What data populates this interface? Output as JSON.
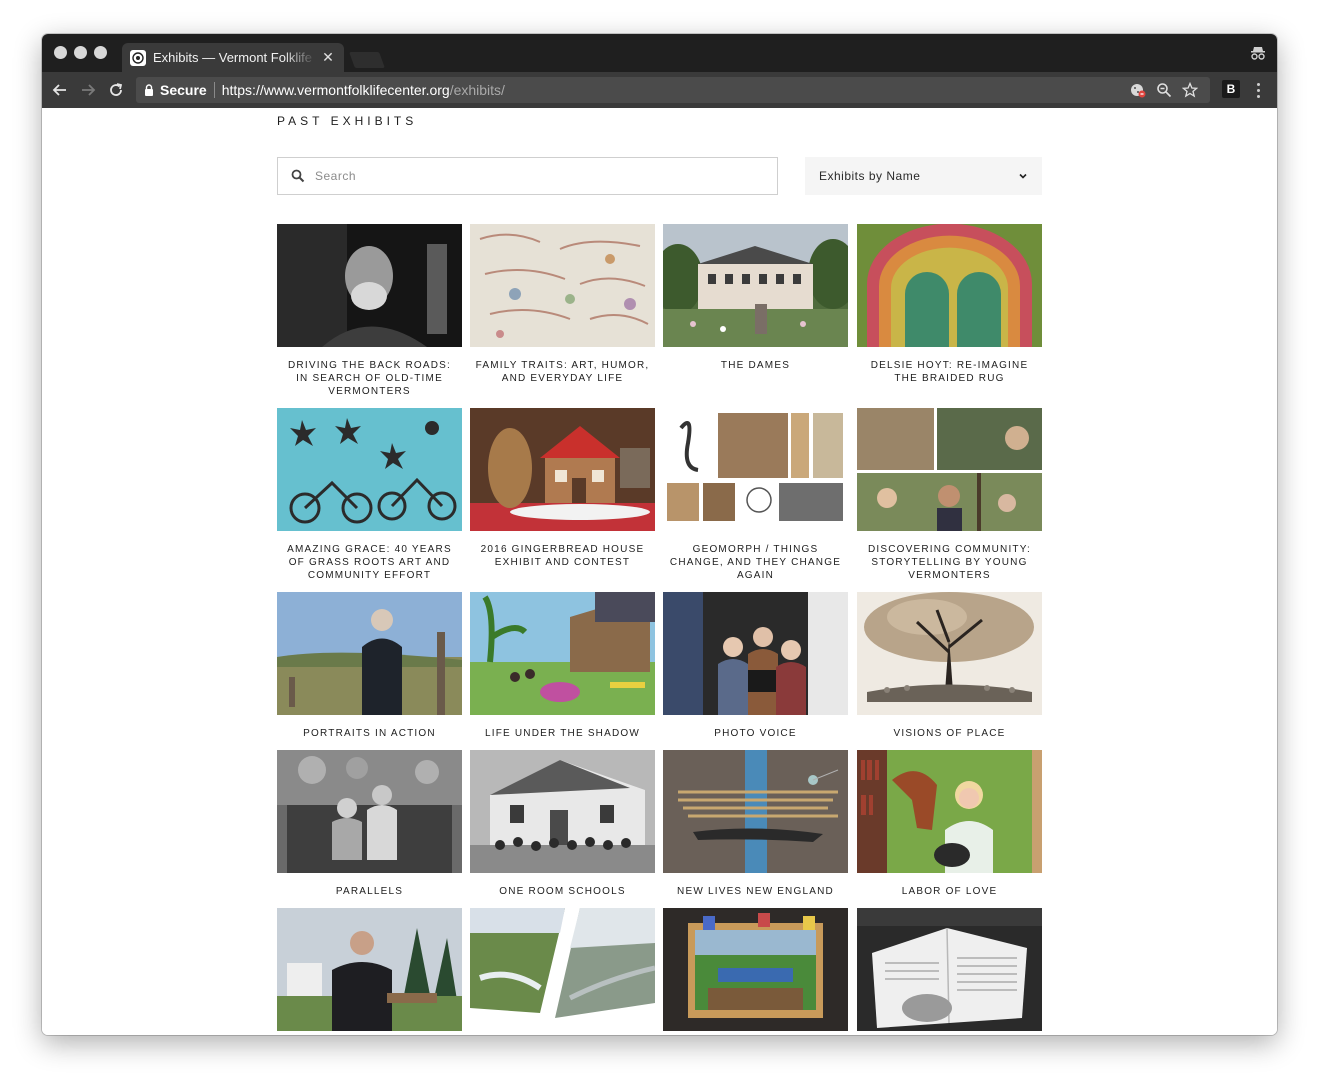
{
  "browser": {
    "tab_title": "Exhibits — Vermont Folklife Center",
    "secure_label": "Secure",
    "url_host": "https://www.vermontfolklifecenter.org",
    "url_path": "/exhibits/",
    "extension_label": "B"
  },
  "page": {
    "title": "PAST EXHIBITS",
    "search_placeholder": "Search",
    "sort_select": "Exhibits by Name"
  },
  "exhibits": [
    {
      "title": "DRIVING THE BACK ROADS: IN SEARCH OF OLD-TIME VERMONTERS"
    },
    {
      "title": "FAMILY TRAITS: ART, HUMOR, AND EVERYDAY LIFE"
    },
    {
      "title": "THE DAMES"
    },
    {
      "title": "DELSIE HOYT: RE-IMAGINE THE BRAIDED RUG"
    },
    {
      "title": "AMAZING GRACE: 40 YEARS OF GRASS ROOTS ART AND COMMUNITY EFFORT"
    },
    {
      "title": "2016 GINGERBREAD HOUSE EXHIBIT AND CONTEST"
    },
    {
      "title": "GEOMORPH / THINGS CHANGE, AND THEY CHANGE AGAIN"
    },
    {
      "title": "DISCOVERING COMMUNITY: STORYTELLING BY YOUNG VERMONTERS"
    },
    {
      "title": "PORTRAITS IN ACTION"
    },
    {
      "title": "LIFE UNDER THE SHADOW"
    },
    {
      "title": "PHOTO VOICE"
    },
    {
      "title": "VISIONS OF PLACE"
    },
    {
      "title": "PARALLELS"
    },
    {
      "title": "ONE ROOM SCHOOLS"
    },
    {
      "title": "NEW LIVES NEW ENGLAND"
    },
    {
      "title": "LABOR OF LOVE"
    },
    {
      "title": ""
    },
    {
      "title": ""
    },
    {
      "title": ""
    },
    {
      "title": ""
    }
  ]
}
